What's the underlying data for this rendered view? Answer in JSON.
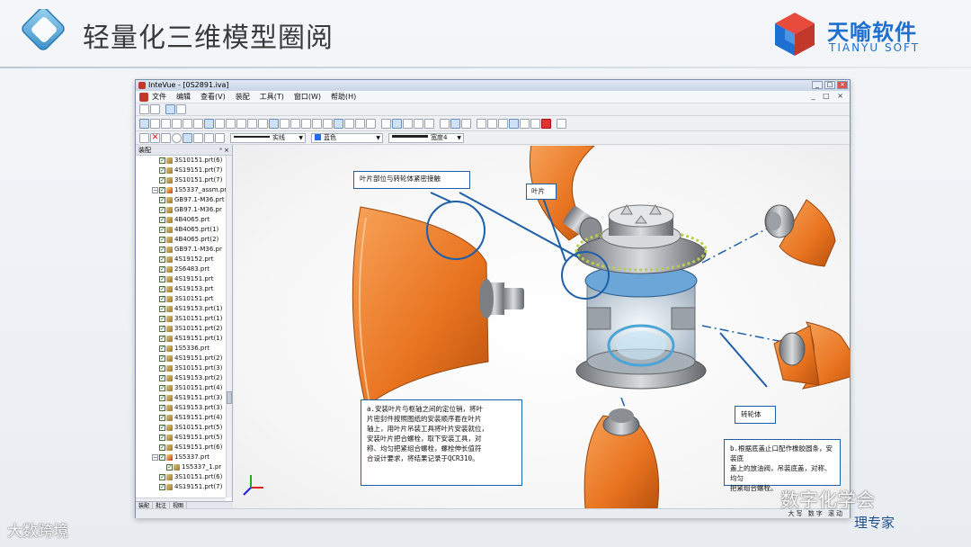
{
  "slide": {
    "title": "轻量化三维模型圈阅",
    "brand_cn": "天喻软件",
    "brand_en": "TIANYU SOFT"
  },
  "window": {
    "title": "InteVue - [0S2891.iva]",
    "controls": [
      "_",
      "□",
      "×"
    ]
  },
  "menu": {
    "items": [
      "文件",
      "编辑",
      "查看(V)",
      "装配",
      "工具(T)",
      "窗口(W)",
      "帮助(H)"
    ],
    "right": "_ □ ×"
  },
  "toolbar": {
    "line_style": "实线",
    "color": "蓝色",
    "width": "宽度4"
  },
  "panel": {
    "header": "装配",
    "pin": "ᵃ ×",
    "tabs": [
      "装配",
      "批注",
      "视图"
    ],
    "tree": [
      {
        "label": "3S10151.prt(6)",
        "indent": 2
      },
      {
        "label": "4S19151.prt(7)",
        "indent": 2
      },
      {
        "label": "3S10151.prt(7)",
        "indent": 2
      },
      {
        "label": "1S5337_assm.prt(2",
        "indent": 1,
        "assembly": true
      },
      {
        "label": "GB97.1-M36.prt",
        "indent": 2
      },
      {
        "label": "GB97.1-M36.pr",
        "indent": 2
      },
      {
        "label": "4B4065.prt",
        "indent": 2
      },
      {
        "label": "4B4065.prt(1)",
        "indent": 2
      },
      {
        "label": "4B4065.prt(2)",
        "indent": 2
      },
      {
        "label": "GB97.1-M36.pr",
        "indent": 2
      },
      {
        "label": "4S19152.prt",
        "indent": 2
      },
      {
        "label": "2S6483.prt",
        "indent": 2
      },
      {
        "label": "4S19151.prt",
        "indent": 2
      },
      {
        "label": "4S19153.prt",
        "indent": 2
      },
      {
        "label": "3S10151.prt",
        "indent": 2
      },
      {
        "label": "4S19153.prt(1)",
        "indent": 2
      },
      {
        "label": "3S10151.prt(1)",
        "indent": 2
      },
      {
        "label": "3S10151.prt(2)",
        "indent": 2
      },
      {
        "label": "4S19151.prt(1)",
        "indent": 2
      },
      {
        "label": "1S5336.prt",
        "indent": 2
      },
      {
        "label": "4S19151.prt(2)",
        "indent": 2
      },
      {
        "label": "3S10151.prt(3)",
        "indent": 2
      },
      {
        "label": "4S19153.prt(2)",
        "indent": 2
      },
      {
        "label": "3S10151.prt(4)",
        "indent": 2
      },
      {
        "label": "4S19151.prt(3)",
        "indent": 2
      },
      {
        "label": "4S19153.prt(3)",
        "indent": 2
      },
      {
        "label": "4S19151.prt(4)",
        "indent": 2
      },
      {
        "label": "3S10151.prt(5)",
        "indent": 2
      },
      {
        "label": "4S19151.prt(5)",
        "indent": 2
      },
      {
        "label": "4S19151.prt(6)",
        "indent": 2
      },
      {
        "label": "1S5337.prt",
        "indent": 1,
        "assembly": true
      },
      {
        "label": "1S5337_1.pr",
        "indent": 3
      },
      {
        "label": "3S10151.prt(6)",
        "indent": 2
      },
      {
        "label": "4S19151.prt(7)",
        "indent": 2
      }
    ]
  },
  "annotations": {
    "callout_top": "叶片部位与转轮体紧密接触",
    "label_blade": "叶片",
    "label_hub": "转轮体",
    "note_a": [
      "a.安装叶片与枢轴之间的定位销，将叶",
      "片密封件按照图纸的安装顺序套在叶片",
      "轴上，用叶片吊装工具将叶片安装就位，",
      "安装叶片把合螺栓，取下安装工具，对",
      "称、均匀把紧组合螺栓，螺栓伸长值符",
      "合设计要求，将结果记录于QCR310。"
    ],
    "note_b": [
      "b.根据底盖止口配作橡胶圆条，安装底",
      "盖上的放油阀，吊装底盖，对称、均匀",
      "把紧组合螺栓。"
    ]
  },
  "status": {
    "right": "大写 数字 滚动"
  },
  "watermarks": {
    "left": "大数跨境",
    "right": "数字化学会",
    "right2": "理专家"
  },
  "colors": {
    "accent": "#1f5fa8",
    "blade": "#e8731f",
    "brand": "#1d6fd1"
  }
}
